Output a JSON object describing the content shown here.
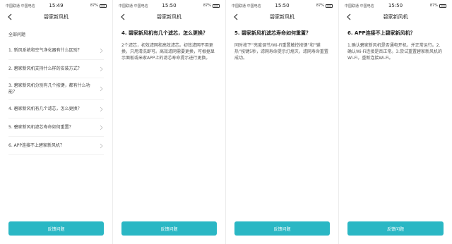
{
  "screens": [
    {
      "status": {
        "carrier": "中国联通 中国电信",
        "time": "15:49",
        "battery": "87%"
      },
      "title": "碧家新风机",
      "section_label": "全部问题",
      "faqs": [
        "1. 新风系统和空气净化器有什么区别？",
        "2. 碧家新风机支持什么样的安装方式？",
        "3. 碧家新风机分别有几个按键，都有什么功能？",
        "4. 碧家新风机有几个滤芯，怎么更换？",
        "5. 碧家新风机滤芯寿命如何重置？",
        "6. APP连接不上碧家新风机？"
      ],
      "button": "反馈问题"
    },
    {
      "status": {
        "carrier": "中国联通 中国电信",
        "time": "15:50",
        "battery": "87%"
      },
      "title": "碧家新风机",
      "question": "4. 碧家新风机有几个滤芯，怎么更换？",
      "answer": "2个滤芯，初效滤网和高效滤芯。初效滤网不用更换，只用清洗即可。高效滤网需要更换，可根据显示面板或米家APP上的滤芯寿命提示进行更换。",
      "button": "反馈问题"
    },
    {
      "status": {
        "carrier": "中国联通 中国电信",
        "time": "15:50",
        "battery": "87%"
      },
      "title": "碧家新风机",
      "question": "5. 碧家新风机滤芯寿命如何重置？",
      "answer": "同时按下“亮度调节/Wi-Fi重置触控按键”和“辅热”按键5秒，滤网寿命提示灯熄灭，滤网寿命重置成功。",
      "button": "反馈问题"
    },
    {
      "status": {
        "carrier": "中国联通 中国电信",
        "time": "15:50",
        "battery": "87%"
      },
      "title": "碧家新风机",
      "question": "6. APP连接不上碧家新风机？",
      "answer": "1.确认碧家新风机是否通电开机，并正常运行。2.确认Wi-Fi连接是否正常。3.尝试重置碧家新风机的Wi-Fi，重新连接Wi-Fi。",
      "button": "反馈问题"
    }
  ]
}
